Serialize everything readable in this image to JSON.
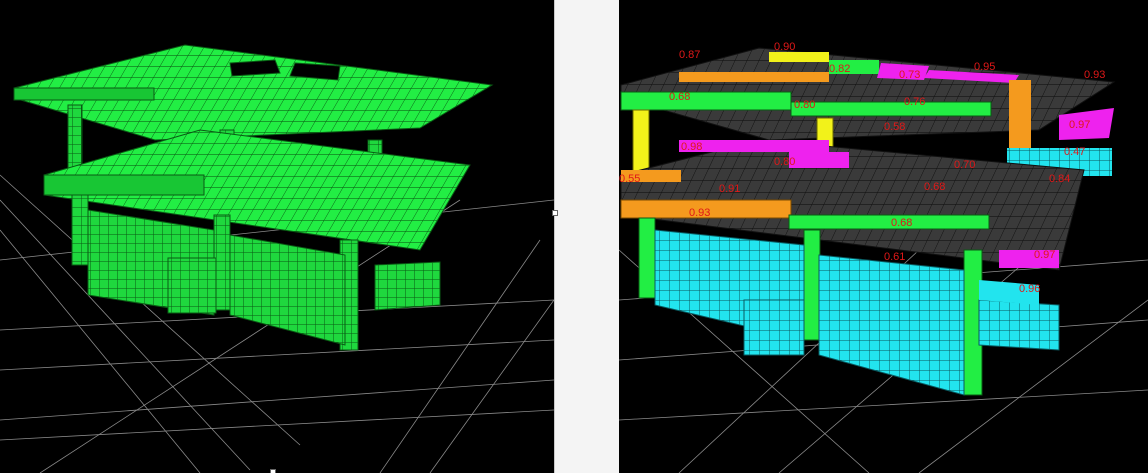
{
  "colors": {
    "background": "#000000",
    "mesh_green": "#22ee44",
    "mesh_line": "#0a5a14",
    "ratio_orange": "#f49a1e",
    "ratio_yellow": "#f2f21a",
    "ratio_magenta": "#ee22ee",
    "ratio_cyan": "#22e4ee",
    "ratio_text": "#e01818",
    "slab_dark": "#3a3a3a",
    "grid": "#9a9a9a"
  },
  "left_view": {
    "name": "model-mesh-view"
  },
  "right_view": {
    "name": "stress-ratio-view",
    "labels": [
      "0.87",
      "0.90",
      "0.82",
      "0.73",
      "0.95",
      "0.93",
      "0.68",
      "0.80",
      "0.76",
      "0.97",
      "0.47",
      "0.58",
      "0.98",
      "0.80",
      "0.70",
      "0.91",
      "0.68",
      "0.93",
      "0.68",
      "0.97",
      "0.96",
      "0.61",
      "0.84",
      "0.55"
    ]
  }
}
